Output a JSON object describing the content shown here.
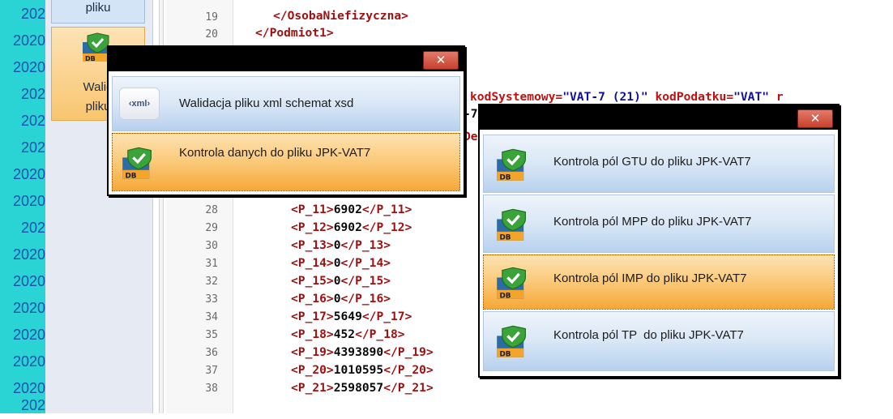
{
  "left_dates": [
    " 202",
    "2020",
    "2020",
    " 202",
    " 202",
    " 202",
    "2020",
    "2020",
    " 202",
    "2020",
    "2020",
    "2020",
    "2020",
    "2020",
    "2020",
    " 202"
  ],
  "side_panel": {
    "plik_label": "pliku",
    "walid_label_line1": "Walid",
    "walid_label_line2": "pliku"
  },
  "editor": {
    "line_numbers": [
      "19",
      "20",
      "28",
      "29",
      "30",
      "31",
      "32",
      "33",
      "34",
      "35",
      "36",
      "37",
      "38"
    ],
    "top_lines": [
      {
        "indent": "    ",
        "tag_text": "</OsobaNiefizyczna>"
      },
      {
        "indent": "  ",
        "tag_text": "</Podmiot1>"
      }
    ],
    "code_lines": [
      {
        "open": "<P_11>",
        "value": "6902",
        "close": "</P_11>"
      },
      {
        "open": "<P_12>",
        "value": "6902",
        "close": "</P_12>"
      },
      {
        "open": "<P_13>",
        "value": "0",
        "close": "</P_13>"
      },
      {
        "open": "<P_14>",
        "value": "0",
        "close": "</P_14>"
      },
      {
        "open": "<P_15>",
        "value": "0",
        "close": "</P_15>"
      },
      {
        "open": "<P_16>",
        "value": "0",
        "close": "</P_16>"
      },
      {
        "open": "<P_17>",
        "value": "5649",
        "close": "</P_17>"
      },
      {
        "open": "<P_18>",
        "value": "452",
        "close": "</P_18>"
      },
      {
        "open": "<P_19>",
        "value": "4393890",
        "close": "</P_19>"
      },
      {
        "open": "<P_20>",
        "value": "1010595",
        "close": "</P_20>"
      },
      {
        "open": "<P_21>",
        "value": "2598057",
        "close": "</P_21>"
      }
    ],
    "attr_line": {
      "attr1": "kodSystemowy=",
      "val1": "\"VAT-7 (21)\"",
      "attr2": " kodPodatku=",
      "val2": "\"VAT\"",
      "tail": " r"
    },
    "fragment_7": "-7",
    "fragment_de": "De"
  },
  "popup1": {
    "close_label": "✕",
    "items": [
      {
        "label": "Walidacja pliku xml schemat xsd",
        "icon": "xml-icon",
        "icon_text": "‹xml›",
        "selected": false
      },
      {
        "label": "Kontrola danych do pliku JPK-VAT7",
        "icon": "db-check-icon",
        "selected": true
      }
    ]
  },
  "popup2": {
    "close_label": "✕",
    "items": [
      {
        "label": "Kontrola pól GTU do pliku JPK-VAT7",
        "selected": false
      },
      {
        "label": "Kontrola pól MPP do pliku JPK-VAT7",
        "selected": false
      },
      {
        "label": "Kontrola pól IMP do pliku JPK-VAT7",
        "selected": true
      },
      {
        "label": "Kontrola pól TP  do pliku JPK-VAT7",
        "selected": false
      }
    ]
  },
  "icons": {
    "db_label": "DB"
  },
  "colors": {
    "teal": "#2ad4d4",
    "orange_selected": "#f8b64b",
    "blue_item": "#cfe0f4",
    "close_red": "#d0503e"
  }
}
